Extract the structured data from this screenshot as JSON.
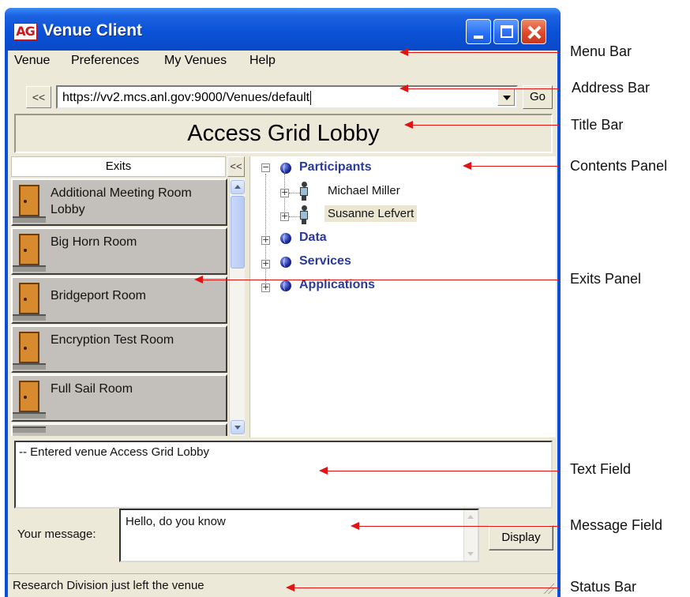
{
  "window": {
    "app_icon": "AG",
    "title": "Venue Client",
    "controls": [
      "minimize-icon",
      "maximize-icon",
      "close-icon"
    ]
  },
  "menu": [
    "Venue",
    "Preferences",
    "My Venues",
    "Help"
  ],
  "address": {
    "back_label": "<<",
    "url": "https://vv2.mcs.anl.gov:9000/Venues/default",
    "go_label": "Go"
  },
  "venue_title": "Access Grid Lobby",
  "exits": {
    "header": "Exits",
    "collapse_label": "<<",
    "items": [
      "Additional Meeting Room Lobby",
      "Big Horn Room",
      "Bridgeport Room",
      "Encryption Test Room",
      "Full Sail Room"
    ]
  },
  "contents": {
    "categories": [
      {
        "label": "Participants",
        "expander": "−"
      },
      {
        "label": "Data",
        "expander": "+"
      },
      {
        "label": "Services",
        "expander": "+"
      },
      {
        "label": "Applications",
        "expander": "+"
      }
    ],
    "participants": [
      {
        "name": "Michael Miller",
        "expander": "+"
      },
      {
        "name": "Susanne Lefvert",
        "expander": "+"
      }
    ]
  },
  "text_field": "-- Entered venue Access Grid Lobby",
  "message": {
    "label": "Your message:",
    "value": "Hello, do you know",
    "display_label": "Display"
  },
  "status": "Research Division just left the venue",
  "callouts": [
    "Menu Bar",
    "Address Bar",
    "Title Bar",
    "Contents Panel",
    "Exits Panel",
    "Text Field",
    "Message Field",
    "Status Bar"
  ],
  "colors": {
    "titlebar_blue": "#0a52d8",
    "window_face": "#ece9d8",
    "category_text": "#2a3a9a",
    "callout_red": "#e01414",
    "exit_item_gray": "#c3c0bb"
  }
}
